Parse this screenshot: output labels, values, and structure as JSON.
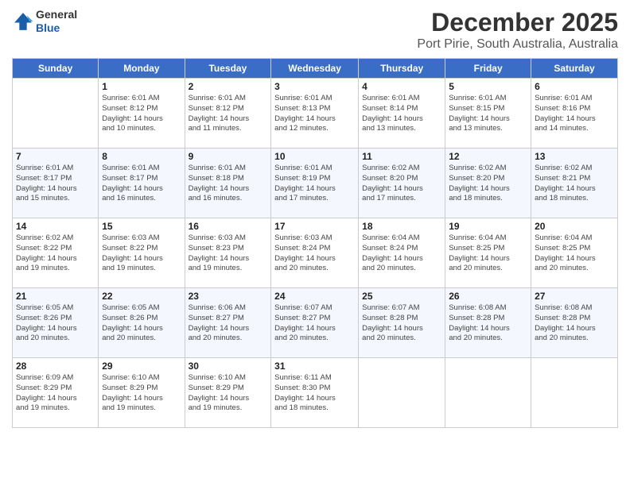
{
  "header": {
    "logo": {
      "line1": "General",
      "line2": "Blue"
    },
    "title": "December 2025",
    "subtitle": "Port Pirie, South Australia, Australia"
  },
  "calendar": {
    "days_of_week": [
      "Sunday",
      "Monday",
      "Tuesday",
      "Wednesday",
      "Thursday",
      "Friday",
      "Saturday"
    ],
    "weeks": [
      [
        {
          "day": "",
          "info": ""
        },
        {
          "day": "1",
          "info": "Sunrise: 6:01 AM\nSunset: 8:12 PM\nDaylight: 14 hours\nand 10 minutes."
        },
        {
          "day": "2",
          "info": "Sunrise: 6:01 AM\nSunset: 8:12 PM\nDaylight: 14 hours\nand 11 minutes."
        },
        {
          "day": "3",
          "info": "Sunrise: 6:01 AM\nSunset: 8:13 PM\nDaylight: 14 hours\nand 12 minutes."
        },
        {
          "day": "4",
          "info": "Sunrise: 6:01 AM\nSunset: 8:14 PM\nDaylight: 14 hours\nand 13 minutes."
        },
        {
          "day": "5",
          "info": "Sunrise: 6:01 AM\nSunset: 8:15 PM\nDaylight: 14 hours\nand 13 minutes."
        },
        {
          "day": "6",
          "info": "Sunrise: 6:01 AM\nSunset: 8:16 PM\nDaylight: 14 hours\nand 14 minutes."
        }
      ],
      [
        {
          "day": "7",
          "info": "Sunrise: 6:01 AM\nSunset: 8:17 PM\nDaylight: 14 hours\nand 15 minutes."
        },
        {
          "day": "8",
          "info": "Sunrise: 6:01 AM\nSunset: 8:17 PM\nDaylight: 14 hours\nand 16 minutes."
        },
        {
          "day": "9",
          "info": "Sunrise: 6:01 AM\nSunset: 8:18 PM\nDaylight: 14 hours\nand 16 minutes."
        },
        {
          "day": "10",
          "info": "Sunrise: 6:01 AM\nSunset: 8:19 PM\nDaylight: 14 hours\nand 17 minutes."
        },
        {
          "day": "11",
          "info": "Sunrise: 6:02 AM\nSunset: 8:20 PM\nDaylight: 14 hours\nand 17 minutes."
        },
        {
          "day": "12",
          "info": "Sunrise: 6:02 AM\nSunset: 8:20 PM\nDaylight: 14 hours\nand 18 minutes."
        },
        {
          "day": "13",
          "info": "Sunrise: 6:02 AM\nSunset: 8:21 PM\nDaylight: 14 hours\nand 18 minutes."
        }
      ],
      [
        {
          "day": "14",
          "info": "Sunrise: 6:02 AM\nSunset: 8:22 PM\nDaylight: 14 hours\nand 19 minutes."
        },
        {
          "day": "15",
          "info": "Sunrise: 6:03 AM\nSunset: 8:22 PM\nDaylight: 14 hours\nand 19 minutes."
        },
        {
          "day": "16",
          "info": "Sunrise: 6:03 AM\nSunset: 8:23 PM\nDaylight: 14 hours\nand 19 minutes."
        },
        {
          "day": "17",
          "info": "Sunrise: 6:03 AM\nSunset: 8:24 PM\nDaylight: 14 hours\nand 20 minutes."
        },
        {
          "day": "18",
          "info": "Sunrise: 6:04 AM\nSunset: 8:24 PM\nDaylight: 14 hours\nand 20 minutes."
        },
        {
          "day": "19",
          "info": "Sunrise: 6:04 AM\nSunset: 8:25 PM\nDaylight: 14 hours\nand 20 minutes."
        },
        {
          "day": "20",
          "info": "Sunrise: 6:04 AM\nSunset: 8:25 PM\nDaylight: 14 hours\nand 20 minutes."
        }
      ],
      [
        {
          "day": "21",
          "info": "Sunrise: 6:05 AM\nSunset: 8:26 PM\nDaylight: 14 hours\nand 20 minutes."
        },
        {
          "day": "22",
          "info": "Sunrise: 6:05 AM\nSunset: 8:26 PM\nDaylight: 14 hours\nand 20 minutes."
        },
        {
          "day": "23",
          "info": "Sunrise: 6:06 AM\nSunset: 8:27 PM\nDaylight: 14 hours\nand 20 minutes."
        },
        {
          "day": "24",
          "info": "Sunrise: 6:07 AM\nSunset: 8:27 PM\nDaylight: 14 hours\nand 20 minutes."
        },
        {
          "day": "25",
          "info": "Sunrise: 6:07 AM\nSunset: 8:28 PM\nDaylight: 14 hours\nand 20 minutes."
        },
        {
          "day": "26",
          "info": "Sunrise: 6:08 AM\nSunset: 8:28 PM\nDaylight: 14 hours\nand 20 minutes."
        },
        {
          "day": "27",
          "info": "Sunrise: 6:08 AM\nSunset: 8:28 PM\nDaylight: 14 hours\nand 20 minutes."
        }
      ],
      [
        {
          "day": "28",
          "info": "Sunrise: 6:09 AM\nSunset: 8:29 PM\nDaylight: 14 hours\nand 19 minutes."
        },
        {
          "day": "29",
          "info": "Sunrise: 6:10 AM\nSunset: 8:29 PM\nDaylight: 14 hours\nand 19 minutes."
        },
        {
          "day": "30",
          "info": "Sunrise: 6:10 AM\nSunset: 8:29 PM\nDaylight: 14 hours\nand 19 minutes."
        },
        {
          "day": "31",
          "info": "Sunrise: 6:11 AM\nSunset: 8:30 PM\nDaylight: 14 hours\nand 18 minutes."
        },
        {
          "day": "",
          "info": ""
        },
        {
          "day": "",
          "info": ""
        },
        {
          "day": "",
          "info": ""
        }
      ]
    ]
  }
}
